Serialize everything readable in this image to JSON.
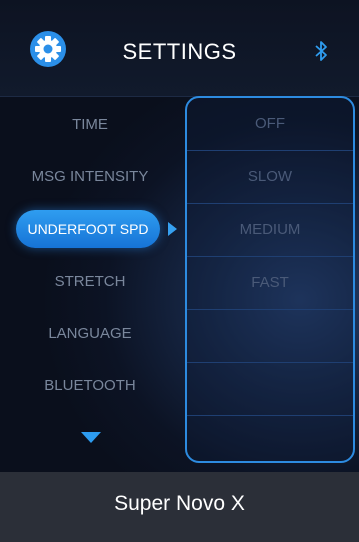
{
  "header": {
    "title": "SETTINGS",
    "settings_icon": "gear-icon",
    "bluetooth_icon": "bluetooth-icon"
  },
  "menu": {
    "items": [
      {
        "label": "TIME"
      },
      {
        "label": "MSG INTENSITY"
      },
      {
        "label": "UNDERFOOT SPD",
        "selected": true
      },
      {
        "label": "STRETCH"
      },
      {
        "label": "LANGUAGE"
      },
      {
        "label": "BLUETOOTH"
      }
    ],
    "scroll_icon": "chevron-down-icon"
  },
  "options": {
    "items": [
      {
        "label": "OFF"
      },
      {
        "label": "SLOW"
      },
      {
        "label": "MEDIUM"
      },
      {
        "label": "FAST"
      },
      {
        "label": ""
      },
      {
        "label": ""
      },
      {
        "label": ""
      }
    ]
  },
  "footer": {
    "device_name": "Super Novo X"
  },
  "colors": {
    "accent": "#2d9cf0",
    "panel_border": "#2d8be0",
    "footer_bg": "#2b2f38",
    "dim_text": "#7a879c"
  }
}
